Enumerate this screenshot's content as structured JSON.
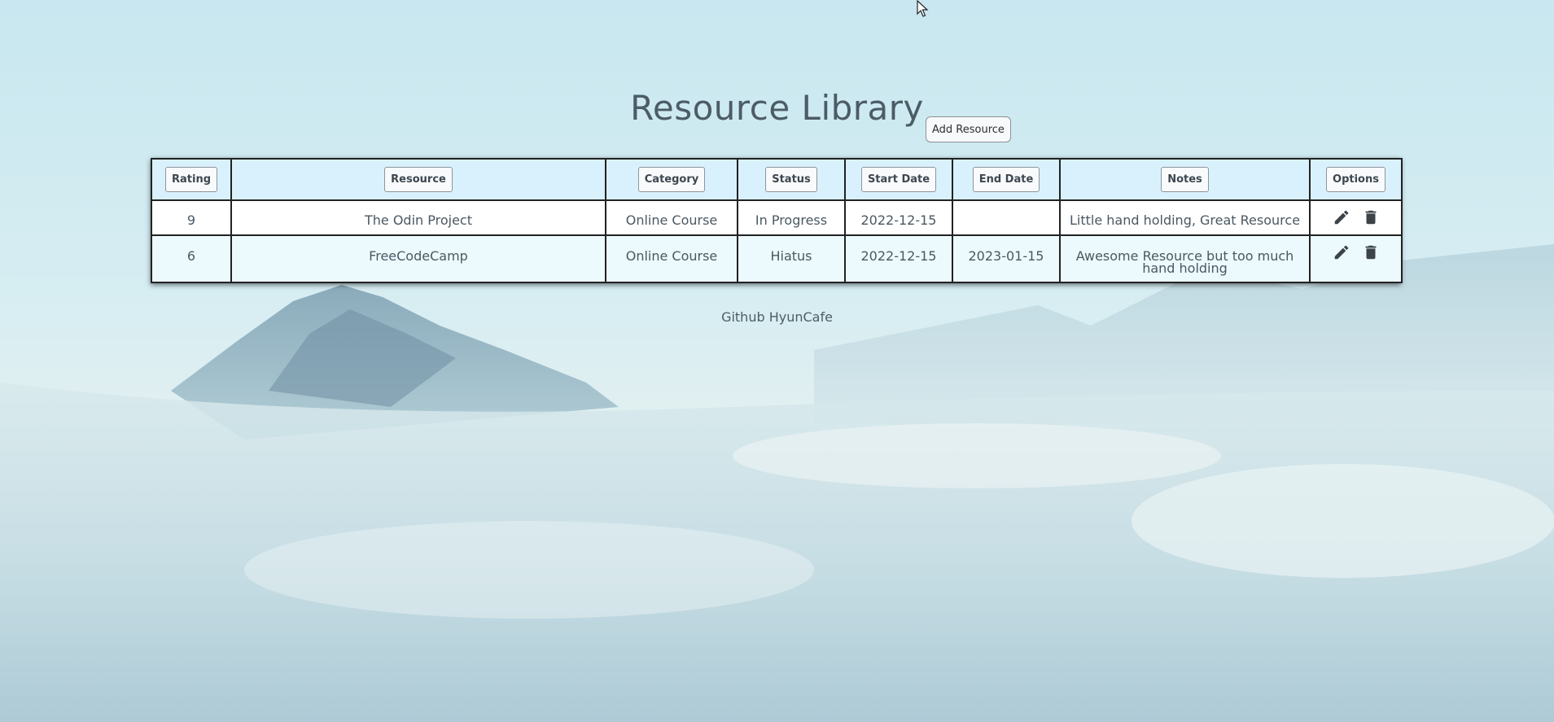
{
  "page": {
    "title": "Resource Library"
  },
  "toolbar": {
    "add_label": "Add Resource"
  },
  "table": {
    "headers": [
      "Rating",
      "Resource",
      "Category",
      "Status",
      "Start Date",
      "End Date",
      "Notes",
      "Options"
    ],
    "rows": [
      {
        "rating": "9",
        "resource": "The Odin Project",
        "category": "Online Course",
        "status": "In Progress",
        "start_date": "2022-12-15",
        "end_date": "",
        "notes": "Little hand holding, Great Resource"
      },
      {
        "rating": "6",
        "resource": "FreeCodeCamp",
        "category": "Online Course",
        "status": "Hiatus",
        "start_date": "2022-12-15",
        "end_date": "2023-01-15",
        "notes": "Awesome Resource but too much hand holding"
      }
    ],
    "option_icons": [
      "pencil-icon",
      "trash-icon"
    ]
  },
  "footer": {
    "link_text": "Github HyunCafe"
  },
  "colors": {
    "header_bg": "#d9f1fc",
    "row_alt_bg": "#ecfafd",
    "text": "#4a5862"
  }
}
